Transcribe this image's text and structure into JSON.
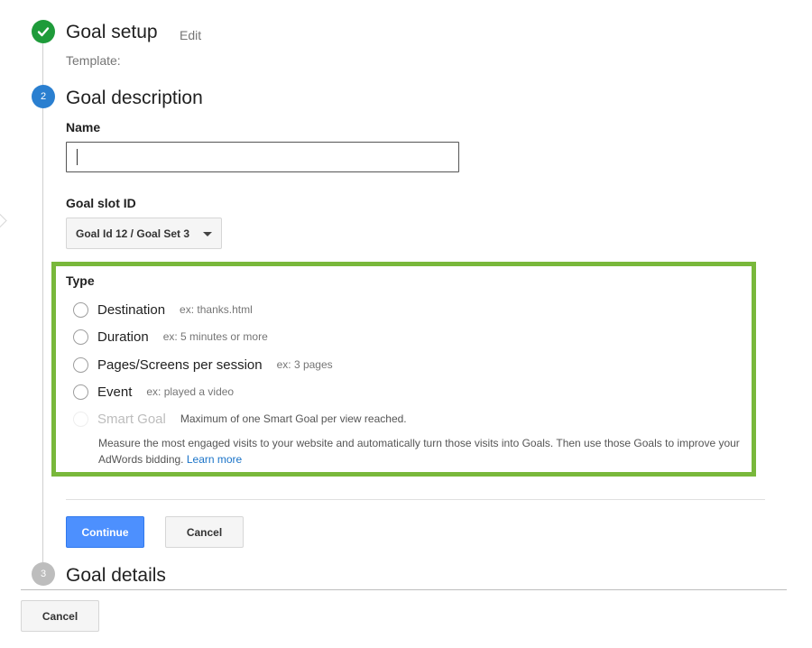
{
  "steps": {
    "setup": {
      "marker_icon": "check-icon",
      "title": "Goal setup",
      "edit_label": "Edit",
      "template_label": "Template:"
    },
    "description": {
      "marker_number": "2",
      "title": "Goal description"
    },
    "details": {
      "marker_number": "3",
      "title": "Goal details"
    }
  },
  "form": {
    "name_label": "Name",
    "name_value": "",
    "slot_label": "Goal slot ID",
    "slot_value": "Goal Id 12 / Goal Set 3",
    "type_label": "Type",
    "types": [
      {
        "label": "Destination",
        "example": "ex: thanks.html",
        "disabled": false
      },
      {
        "label": "Duration",
        "example": "ex: 5 minutes or more",
        "disabled": false
      },
      {
        "label": "Pages/Screens per session",
        "example": "ex: 3 pages",
        "disabled": false
      },
      {
        "label": "Event",
        "example": "ex: played a video",
        "disabled": false
      },
      {
        "label": "Smart Goal",
        "example": "Maximum of one Smart Goal per view reached.",
        "disabled": true
      }
    ],
    "smart_goal_description": "Measure the most engaged visits to your website and automatically turn those visits into Goals. Then use those Goals to improve your AdWords bidding.",
    "learn_more_label": "Learn more"
  },
  "buttons": {
    "continue_label": "Continue",
    "cancel_label": "Cancel",
    "bottom_cancel_label": "Cancel"
  },
  "colors": {
    "step_done": "#1e9b3a",
    "step_active": "#2a7fd0",
    "step_pending": "#bdbdbd",
    "highlight_border": "#79b83b",
    "primary_button": "#4d90fe",
    "link": "#1a73c8"
  }
}
